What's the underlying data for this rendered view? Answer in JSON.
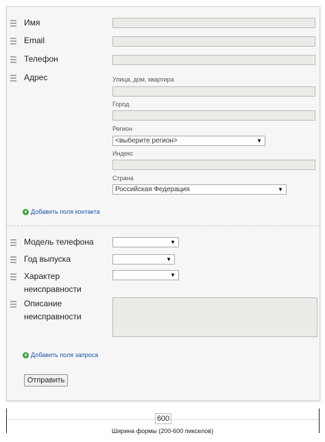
{
  "fields": {
    "name_label": "Имя",
    "email_label": "Email",
    "phone_label": "Телефон",
    "address_label": "Адрес",
    "address_street_label": "Улица, дом, квартира",
    "address_city_label": "Город",
    "address_region_label": "Регион",
    "address_region_value": "<выберите регион>",
    "address_zip_label": "Индекс",
    "address_country_label": "Страна",
    "address_country_value": "Российская Федерация",
    "add_contact_fields_link": "Добавить поля контакта",
    "phone_model_label": "Модель телефона",
    "year_label": "Год выпуска",
    "fault_label_line1": "Характер",
    "fault_label_line2": "неисправности",
    "description_label_line1": "Описание",
    "description_label_line2": "неисправности",
    "add_request_fields_link": "Добавить поля запроса",
    "submit_label": "Отправить"
  },
  "ruler": {
    "value": "600",
    "caption": "Ширина формы (200-600 пикселов)"
  },
  "icons": {
    "drag_handle": "drag-handle-icon",
    "add": "plus-circle-icon",
    "dropdown": "chevron-down-icon"
  },
  "colors": {
    "link": "#1a57a8",
    "add_icon": "#3b9e3b",
    "input_bg": "#ebebe8",
    "card_bg": "#f6f6f6"
  }
}
